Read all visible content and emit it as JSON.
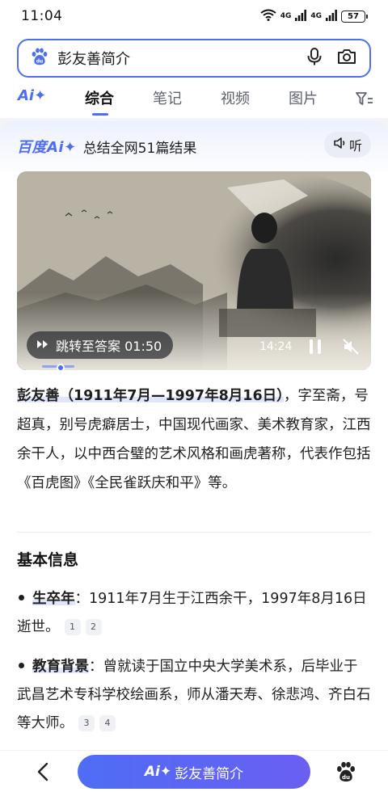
{
  "status_bar": {
    "time": "11:04",
    "signal1_label": "4G",
    "signal2_label": "4G",
    "battery": "57"
  },
  "search": {
    "query": "彭友善简介"
  },
  "tabs": [
    {
      "label": "Ai✦"
    },
    {
      "label": "综合"
    },
    {
      "label": "笔记"
    },
    {
      "label": "视频"
    },
    {
      "label": "图片"
    }
  ],
  "ai_card": {
    "brand": "百度Ai✦",
    "summary": "总结全网51篇结果",
    "listen_label": "听"
  },
  "video": {
    "jump_label": "跳转至答案 01:50",
    "duration": "14:24",
    "progress_fraction": 0.035
  },
  "intro": {
    "name_dates": "彭友善（1911年7月—1997年8月16日）",
    "text": "，字至斋，号超真，别号虎癖居士，中国现代画家、美术教育家，江西余干人，以中西合璧的艺术风格和画虎著称，代表作包括《百虎图》《全民雀跃庆和平》等。"
  },
  "basic_info": {
    "title": "基本信息",
    "items": [
      {
        "key": "生卒年",
        "sep": "：",
        "text": "1911年7月生于江西余干，1997年8月16日逝世。",
        "refs": [
          "1",
          "2"
        ]
      },
      {
        "key": "教育背景",
        "sep": "：",
        "text": "曾就读于国立中央大学美术系，后毕业于武昌艺术专科学校绘画系，师从潘天寿、徐悲鸿、齐白石等大师。",
        "refs": [
          "3",
          "4"
        ]
      }
    ]
  },
  "bottom_bar": {
    "pill_ai": "Ai✦",
    "pill_text": "彭友善简介"
  },
  "colors": {
    "accent": "#4e6ef2",
    "pill_gradient_start": "#4f6df5",
    "pill_gradient_end": "#6a5ff2"
  },
  "icons": [
    "wifi-icon",
    "signal-icon",
    "battery-icon",
    "baidu-paw-icon",
    "microphone-icon",
    "camera-icon",
    "filter-icon",
    "speaker-icon",
    "play-forward-icon",
    "pause-icon",
    "mute-icon",
    "back-arrow-icon"
  ]
}
